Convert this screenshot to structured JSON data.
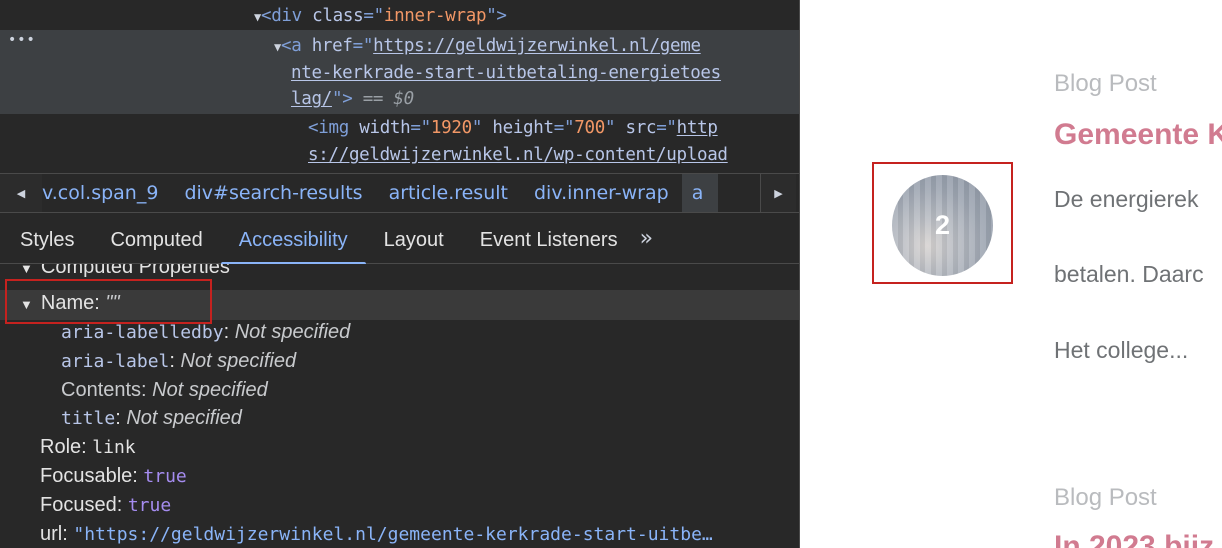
{
  "devtools": {
    "elements": {
      "line1": {
        "open": "<",
        "tag": "div",
        "attr": "class",
        "eq": "=\"",
        "val": "inner-wrap",
        "close": "\">"
      },
      "line2": {
        "open": "<",
        "tag": "a",
        "attr": "href",
        "eq": "=\"",
        "url_part1": "https://geldwijzerwinkel.nl/geme"
      },
      "line3": {
        "url_part2": "nte-kerkrade-start-uitbetaling-energietoes"
      },
      "line4": {
        "url_part3": "lag/",
        "close": "\">",
        "eq_sign": "==",
        "var": "$0"
      },
      "line5": {
        "open": "<",
        "tag": "img",
        "attr1": "width",
        "val1": "1920",
        "attr2": "height",
        "val2": "700",
        "attr3": "src",
        "url_part1": "http"
      },
      "line6": {
        "url_part2": "s://geldwijzerwinkel.nl/wp-content/upload"
      },
      "dots": "•••"
    },
    "breadcrumbs": [
      {
        "tag": "",
        "rest": "v.col.span_9"
      },
      {
        "tag": "div",
        "rest": "#search-results"
      },
      {
        "tag": "article",
        "rest": ".result"
      },
      {
        "tag": "div",
        "rest": ".inner-wrap"
      },
      {
        "tag": "a",
        "rest": ""
      }
    ],
    "tabs": [
      "Styles",
      "Computed",
      "Accessibility",
      "Layout",
      "Event Listeners"
    ],
    "tabs_more": "»",
    "a11y": {
      "section": "Computed Properties",
      "name_key": "Name:",
      "name_val": "\"\"",
      "aria_labelledby_key": "aria-labelledby",
      "aria_labelledby_val": "Not specified",
      "aria_label_key": "aria-label",
      "aria_label_val": "Not specified",
      "contents_key": "Contents:",
      "contents_val": "Not specified",
      "title_key": "title",
      "title_val": "Not specified",
      "role_key": "Role:",
      "role_val": "link",
      "focusable_key": "Focusable:",
      "focusable_val": "true",
      "focused_key": "Focused:",
      "focused_val": "true",
      "url_key": "url:",
      "url_val": "\"https://geldwijzerwinkel.nl/gemeente-kerkrade-start-uitbe…"
    }
  },
  "webpage": {
    "post1": {
      "label": "Blog Post",
      "title": "Gemeente K",
      "text1": "De energierek",
      "text2": "betalen. Daarc",
      "text3": "Het college...",
      "thumb_number": "2"
    },
    "post2": {
      "label": "Blog Post",
      "title": "In 2023 bijz"
    }
  },
  "colors": {
    "devtools_bg": "#282828",
    "accent_blue": "#8ab4f8",
    "highlight_red": "#c5221f",
    "post_title_pink": "#d17b90"
  }
}
